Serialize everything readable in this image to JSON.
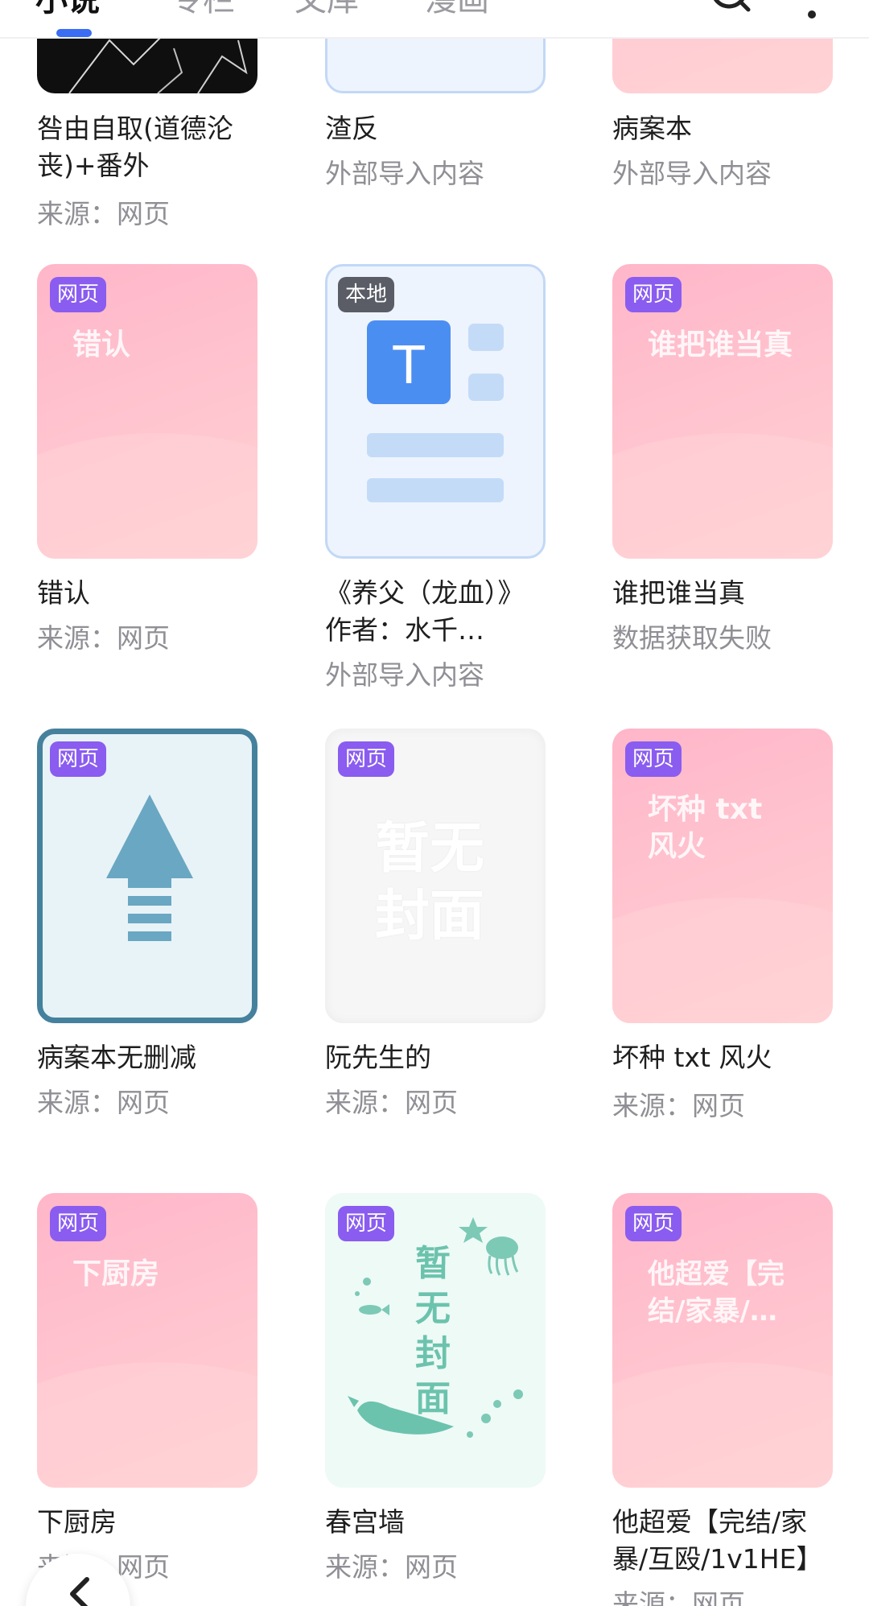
{
  "tabs": [
    {
      "label": "小说",
      "active": true
    },
    {
      "label": "专栏",
      "active": false
    },
    {
      "label": "文库",
      "active": false
    },
    {
      "label": "漫画",
      "active": false
    }
  ],
  "icons": {
    "search": "search-icon",
    "more": "more-vertical-icon",
    "back": "chevron-left-icon"
  },
  "colors": {
    "accent": "#3a6cf4",
    "badge_web": "#8a5cf0",
    "badge_local": "#5a5d66"
  },
  "books": [
    {
      "title": "咎由自取(道德沦丧)+番外",
      "sub": "来源：网页"
    },
    {
      "title": "渣反",
      "sub": "外部导入内容"
    },
    {
      "title": "病案本",
      "sub": "外部导入内容"
    },
    {
      "badge": "网页",
      "cover_title": "错认",
      "title": "错认",
      "sub": "来源：网页"
    },
    {
      "badge": "本地",
      "title": "《养父（龙血）》作者：水千…",
      "sub": "外部导入内容"
    },
    {
      "badge": "网页",
      "cover_title": "谁把谁当真",
      "title": "谁把谁当真",
      "sub": "数据获取失败"
    },
    {
      "badge": "网页",
      "title": "病案本无删减",
      "sub": "来源：网页"
    },
    {
      "badge": "网页",
      "cover_title": "暂无封面",
      "title": "阮先生的",
      "sub": "来源：网页"
    },
    {
      "badge": "网页",
      "cover_title": "坏种 txt 风火",
      "title": "坏种 txt 风火",
      "sub": "来源：网页"
    },
    {
      "badge": "网页",
      "cover_title": "下厨房",
      "title": "下厨房",
      "sub": "来源：网页"
    },
    {
      "badge": "网页",
      "cover_title": "暂无封面",
      "title": "春宫墙",
      "sub": "来源：网页"
    },
    {
      "badge": "网页",
      "cover_title": "他超爱【完结/家暴/…",
      "title": "他超爱【完结/家暴/互殴/1v1HE】",
      "sub": "来源：网页"
    }
  ]
}
